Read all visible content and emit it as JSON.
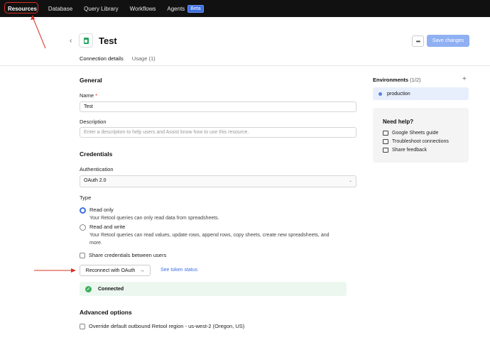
{
  "nav": {
    "items": [
      {
        "label": "Resources",
        "active": true
      },
      {
        "label": "Database"
      },
      {
        "label": "Query Library"
      },
      {
        "label": "Workflows"
      },
      {
        "label": "Agents"
      }
    ],
    "beta_badge": "Beta"
  },
  "header": {
    "title": "Test",
    "more_label": "•••",
    "save_label": "Save changes"
  },
  "tabs": [
    {
      "label": "Connection details",
      "active": true
    },
    {
      "label": "Usage (1)"
    }
  ],
  "general": {
    "heading": "General",
    "name_label": "Name",
    "name_required": "*",
    "name_value": "Test",
    "description_label": "Description",
    "description_placeholder": "Enter a description to help users and Assist know how to use this resource."
  },
  "credentials": {
    "heading": "Credentials",
    "auth_label": "Authentication",
    "auth_value": "OAuth 2.0",
    "type_label": "Type",
    "read_only_label": "Read only",
    "read_only_hint": "Your Retool queries can only read data from spreadsheets.",
    "read_write_label": "Read and write",
    "read_write_hint_1": "Your Retool queries can read values, update rows, append rows, copy sheets, create new spreadsheets, and",
    "read_write_hint_2": "more.",
    "selected_type": "Read only",
    "share_label": "Share credentials between users",
    "reconnect_label": "Reconnect with OAuth",
    "reconnect_arrow": "→",
    "token_link": "See token status",
    "status": "Connected"
  },
  "advanced": {
    "heading": "Advanced options",
    "override_label": "Override default outbound Retool region - us-west-2 (Oregon, US)"
  },
  "sidebar": {
    "env_title": "Environments",
    "env_count": "(1/2)",
    "add_label": "+",
    "environments": [
      {
        "label": "production"
      }
    ],
    "help_title": "Need help?",
    "help_items": [
      {
        "label": "Google Sheets guide"
      },
      {
        "label": "Troubleshoot connections"
      },
      {
        "label": "Share feedback"
      }
    ]
  },
  "colors": {
    "accent": "#3d6fe0",
    "annotation": "#d93025",
    "connected_bg": "#ecf8ef",
    "sheets_green": "#22a45d"
  }
}
